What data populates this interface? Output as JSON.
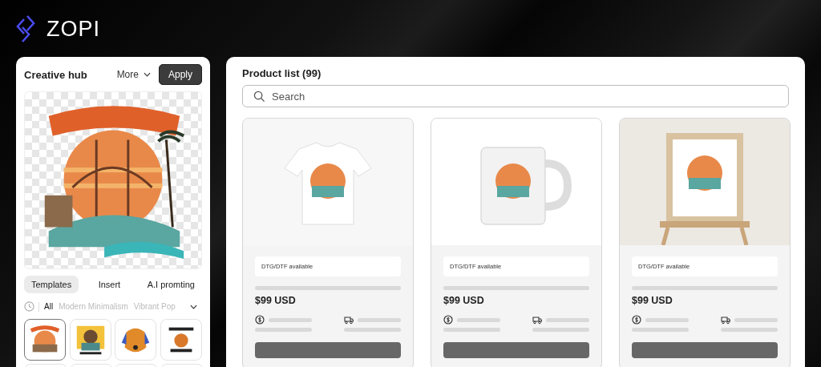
{
  "brand": {
    "name": "ZOPI"
  },
  "creative_hub": {
    "title": "Creative hub",
    "more": "More",
    "apply": "Apply",
    "tabs": [
      {
        "label": "Templates",
        "selected": true
      },
      {
        "label": "Insert",
        "selected": false
      },
      {
        "label": "A.I promting",
        "selected": false
      }
    ],
    "filters": [
      {
        "label": "All",
        "selected": true
      },
      {
        "label": "Modern Minimalism",
        "selected": false
      },
      {
        "label": "Vibrant Pop",
        "selected": false
      }
    ],
    "templates": [
      {
        "kind": "sunset",
        "selected": true
      },
      {
        "kind": "portrait",
        "selected": false
      },
      {
        "kind": "dog",
        "selected": false
      },
      {
        "kind": "pumpkin",
        "selected": false
      }
    ]
  },
  "product_list": {
    "title": "Product list (99)",
    "search": {
      "placeholder": "Search"
    },
    "products": [
      {
        "kind": "tshirt",
        "tag": "DTG/DTF available",
        "price": "$99 USD"
      },
      {
        "kind": "mug",
        "tag": "DTG/DTF available",
        "price": "$99 USD"
      },
      {
        "kind": "frame",
        "tag": "DTG/DTF available",
        "price": "$99 USD"
      }
    ]
  }
}
